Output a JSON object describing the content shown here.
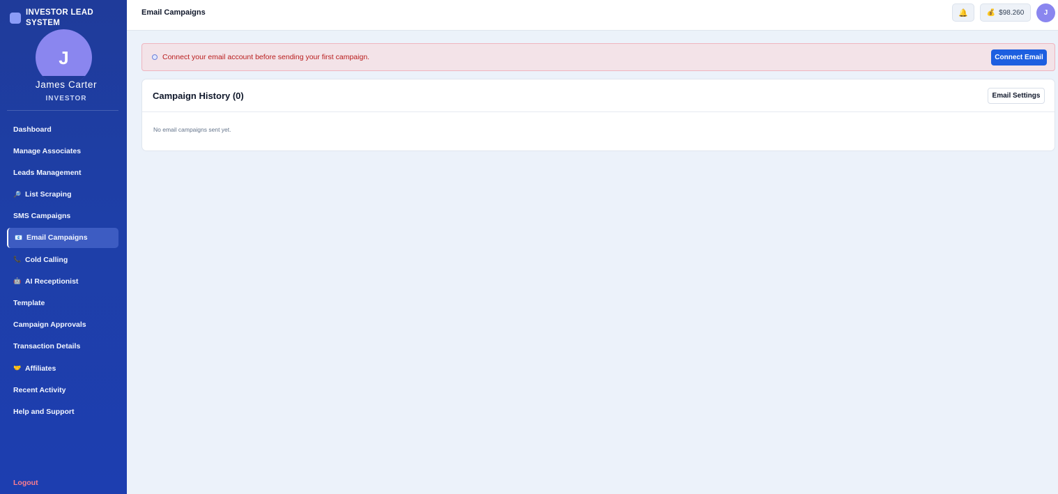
{
  "brand": {
    "title": "INVESTOR LEAD SYSTEM"
  },
  "user": {
    "initial": "J",
    "name": "James Carter",
    "role": "INVESTOR"
  },
  "sidebar": {
    "items": [
      {
        "label": "Dashboard",
        "icon": ""
      },
      {
        "label": "Manage Associates",
        "icon": ""
      },
      {
        "label": "Leads Management",
        "icon": ""
      },
      {
        "label": "List Scraping",
        "icon": "magnifier-icon"
      },
      {
        "label": "SMS Campaigns",
        "icon": ""
      },
      {
        "label": "Email Campaigns",
        "icon": "email-icon",
        "active": true
      },
      {
        "label": "Cold Calling",
        "icon": "phone-icon"
      },
      {
        "label": "AI Receptionist",
        "icon": "robot-icon"
      },
      {
        "label": "Template",
        "icon": ""
      },
      {
        "label": "Campaign Approvals",
        "icon": ""
      },
      {
        "label": "Transaction Details",
        "icon": ""
      },
      {
        "label": "Affiliates",
        "icon": "handshake-icon"
      },
      {
        "label": "Recent Activity",
        "icon": ""
      },
      {
        "label": "Help and Support",
        "icon": ""
      }
    ],
    "logout": "Logout"
  },
  "header": {
    "title": "Email Campaigns",
    "balance": "$98.260",
    "avatar_initial": "J"
  },
  "alert": {
    "text": "Connect your email account before sending your first campaign.",
    "button": "Connect Email"
  },
  "campaigns": {
    "title": "Campaign History (0)",
    "settings_button": "Email Settings",
    "empty": "No email campaigns sent yet."
  },
  "colors": {
    "sidebar": "#1f3b9a",
    "primary": "#1d5fe0",
    "alert_bg": "#f3e3e8",
    "alert_text": "#b91c1c",
    "logout": "#fb7d8f",
    "avatar": "#8a86ef"
  }
}
